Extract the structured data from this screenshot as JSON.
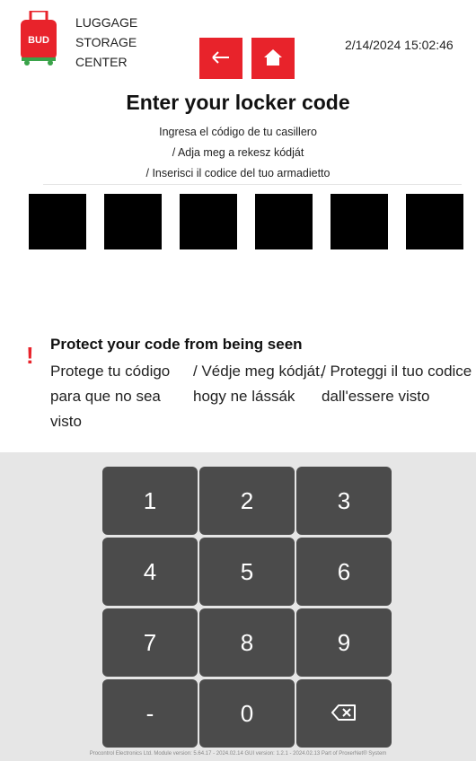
{
  "header": {
    "logo_text": "BUD",
    "brand_lines": [
      "LUGGAGE",
      "STORAGE",
      "CENTER"
    ],
    "datetime": "2/14/2024 15:02:46",
    "colors": {
      "accent": "#e8232b"
    }
  },
  "main": {
    "title": "Enter your locker code",
    "subtitles": [
      "Ingresa el código de tu casillero",
      "/ Adja meg a rekesz kódját",
      "/ Inserisci il codice del tuo armadietto"
    ],
    "code_boxes": 6
  },
  "warning": {
    "icon": "exclamation-icon",
    "title": "Protect your code from being seen",
    "es": "Protege tu código para que no sea visto",
    "hu": "/ Védje meg kódját, hogy ne lássák",
    "it": "/ Proteggi il tuo codice dall'essere visto"
  },
  "keypad": {
    "keys": [
      "1",
      "2",
      "3",
      "4",
      "5",
      "6",
      "7",
      "8",
      "9",
      "-",
      "0",
      "⌫"
    ]
  },
  "footer": {
    "text": "Procontrol Electronics Ltd.  Module version: 5.64.17 - 2024.02.14  GUI version: 1.2.1 - 2024.02.13  Part of ProxerNet® System"
  }
}
